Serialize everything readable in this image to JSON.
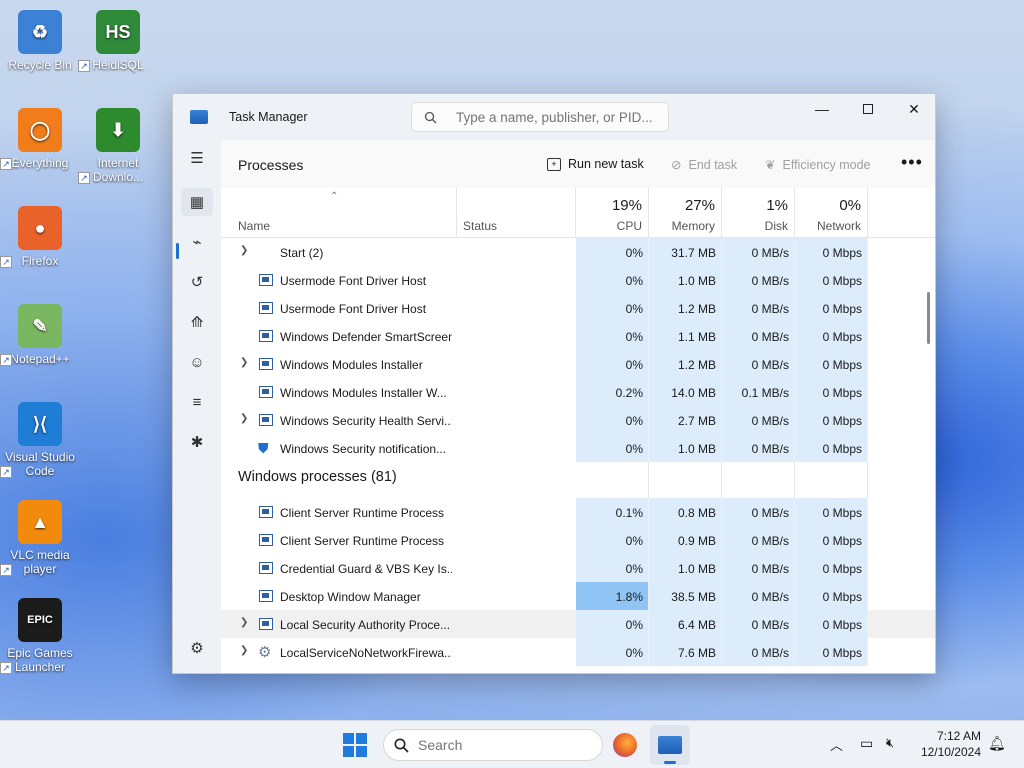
{
  "desktop": {
    "icons": [
      {
        "label_line1": "Recycle Bin",
        "label_line2": "",
        "glyph": "♻",
        "icon": "recycle-bin-icon",
        "color": "#3b82d6"
      },
      {
        "label_line1": "HeidiSQL",
        "label_line2": "",
        "glyph": "HS",
        "icon": "heidisql-icon",
        "color": "#2f8a3a"
      },
      {
        "label_line1": "Everything",
        "label_line2": "",
        "glyph": "◯",
        "icon": "everything-icon",
        "color": "#f07c1a"
      },
      {
        "label_line1": "Internet",
        "label_line2": "Downlo...",
        "glyph": "⬇",
        "icon": "idm-icon",
        "color": "#2d8a2d"
      },
      {
        "label_line1": "Firefox",
        "label_line2": "",
        "glyph": "●",
        "icon": "firefox-icon",
        "color": "#e8622a"
      },
      {
        "label_line1": "Notepad++",
        "label_line2": "",
        "glyph": "✎",
        "icon": "notepadpp-icon",
        "color": "#7bb661"
      },
      {
        "label_line1": "Visual Studio",
        "label_line2": "Code",
        "glyph": "⟩⟨",
        "icon": "vscode-icon",
        "color": "#1f7dd6"
      },
      {
        "label_line1": "VLC media",
        "label_line2": "player",
        "glyph": "▲",
        "icon": "vlc-icon",
        "color": "#f28b0c"
      },
      {
        "label_line1": "Epic Games",
        "label_line2": "Launcher",
        "glyph": "EPIC",
        "icon": "epic-games-icon",
        "color": "#1b1b1b"
      }
    ]
  },
  "window": {
    "title": "Task Manager",
    "search_placeholder": "Type a name, publisher, or PID..."
  },
  "toolbar": {
    "page_title": "Processes",
    "run_new_task": "Run new task",
    "end_task": "End task",
    "efficiency_mode": "Efficiency mode",
    "more": "•••"
  },
  "header": {
    "name": "Name",
    "status": "Status",
    "cpu_pct": "19%",
    "cpu": "CPU",
    "memory_pct": "27%",
    "memory": "Memory",
    "disk_pct": "1%",
    "disk": "Disk",
    "network_pct": "0%",
    "network": "Network"
  },
  "rows": [
    {
      "type": "proc",
      "expand": true,
      "icon": "none",
      "name": "Start (2)",
      "cpu": "0%",
      "memory": "31.7 MB",
      "disk": "0 MB/s",
      "network": "0 Mbps"
    },
    {
      "type": "proc",
      "expand": false,
      "icon": "app",
      "name": "Usermode Font Driver Host",
      "cpu": "0%",
      "memory": "1.0 MB",
      "disk": "0 MB/s",
      "network": "0 Mbps"
    },
    {
      "type": "proc",
      "expand": false,
      "icon": "app",
      "name": "Usermode Font Driver Host",
      "cpu": "0%",
      "memory": "1.2 MB",
      "disk": "0 MB/s",
      "network": "0 Mbps"
    },
    {
      "type": "proc",
      "expand": false,
      "icon": "app",
      "name": "Windows Defender SmartScreen",
      "cpu": "0%",
      "memory": "1.1 MB",
      "disk": "0 MB/s",
      "network": "0 Mbps"
    },
    {
      "type": "proc",
      "expand": true,
      "icon": "app",
      "name": "Windows Modules Installer",
      "cpu": "0%",
      "memory": "1.2 MB",
      "disk": "0 MB/s",
      "network": "0 Mbps"
    },
    {
      "type": "proc",
      "expand": false,
      "icon": "app",
      "name": "Windows Modules Installer W...",
      "cpu": "0.2%",
      "memory": "14.0 MB",
      "disk": "0.1 MB/s",
      "network": "0 Mbps"
    },
    {
      "type": "proc",
      "expand": true,
      "icon": "app",
      "name": "Windows Security Health Servi...",
      "cpu": "0%",
      "memory": "2.7 MB",
      "disk": "0 MB/s",
      "network": "0 Mbps"
    },
    {
      "type": "proc",
      "expand": false,
      "icon": "shield",
      "name": "Windows Security notification...",
      "cpu": "0%",
      "memory": "1.0 MB",
      "disk": "0 MB/s",
      "network": "0 Mbps"
    },
    {
      "type": "group",
      "name": "Windows processes (81)"
    },
    {
      "type": "proc",
      "expand": false,
      "icon": "app",
      "name": "Client Server Runtime Process",
      "cpu": "0.1%",
      "memory": "0.8 MB",
      "disk": "0 MB/s",
      "network": "0 Mbps"
    },
    {
      "type": "proc",
      "expand": false,
      "icon": "app",
      "name": "Client Server Runtime Process",
      "cpu": "0%",
      "memory": "0.9 MB",
      "disk": "0 MB/s",
      "network": "0 Mbps"
    },
    {
      "type": "proc",
      "expand": false,
      "icon": "app",
      "name": "Credential Guard & VBS Key Is...",
      "cpu": "0%",
      "memory": "1.0 MB",
      "disk": "0 MB/s",
      "network": "0 Mbps"
    },
    {
      "type": "proc",
      "expand": false,
      "icon": "app",
      "name": "Desktop Window Manager",
      "cpu": "1.8%",
      "memory": "38.5 MB",
      "disk": "0 MB/s",
      "network": "0 Mbps",
      "cpu_hot": true
    },
    {
      "type": "proc",
      "expand": true,
      "icon": "app",
      "name": "Local Security Authority Proce...",
      "cpu": "0%",
      "memory": "6.4 MB",
      "disk": "0 MB/s",
      "network": "0 Mbps",
      "hover": true
    },
    {
      "type": "proc",
      "expand": true,
      "icon": "gear",
      "name": "LocalServiceNoNetworkFirewa...",
      "cpu": "0%",
      "memory": "7.6 MB",
      "disk": "0 MB/s",
      "network": "0 Mbps"
    }
  ],
  "taskbar": {
    "search_placeholder": "Search",
    "time": "7:12 AM",
    "date": "12/10/2024"
  },
  "colors": {
    "cell_bg": "#dcecfb",
    "cell_hot": "#8fc4f5",
    "accent": "#1f6fd1",
    "hover_row": "#f0f0f0"
  }
}
